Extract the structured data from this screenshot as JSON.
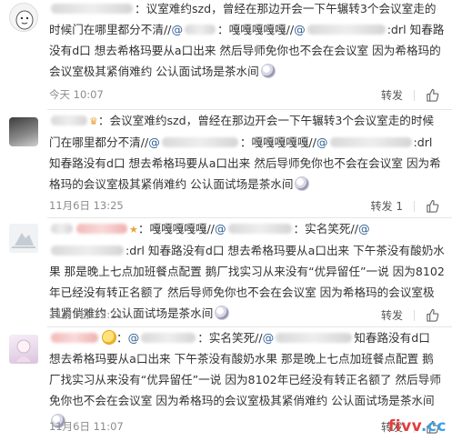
{
  "repost_label": "转发",
  "watermark": {
    "left": "fivv",
    "dot": ".",
    "right": "cc"
  },
  "posts": [
    {
      "prefix": "：",
      "text_a": "议室难约szd，曾经在那边开会一下午辗转3个会议室走的时候门在哪里都分不清//",
      "mention": "@",
      "text_b": "：嘎嘎嘎嘎嘎//",
      "text_c": ":drl 知春路没有d口 想去希格玛要从a口出来 然后导师免你也不会在会议室 因为希格玛的会议室极其紧俏难约 公认面试场是茶水间",
      "time": "今天 10:07",
      "repost": "转发",
      "repost_count": ""
    },
    {
      "prefix": "：",
      "text_a": "会议室难约szd，曾经在那边开会一下午辗转3个会议室走的时候门在哪里都分不清//",
      "mention": "@",
      "text_b": "：嘎嘎嘎嘎嘎//",
      "text_c": ":drl 知春路没有d口 想去希格玛要从a口出来 然后导师免你也不会在会议室 因为希格玛的会议室极其紧俏难约 公认面试场是茶水间",
      "time": "11月6日 13:25",
      "repost": "转发",
      "repost_count": "1"
    },
    {
      "prefix": "：嘎嘎嘎嘎嘎//",
      "mention": "@",
      "text_b": "：实名笑死//",
      "text_c": ":drl 知春路没有d口 想去希格玛要从a口出来 下午茶没有酸奶水果 那是晚上七点加班餐点配置 鹅厂找实习从来没有“优异留任”一说 因为8102年已经没有转正名额了 然后导师免你也不会在会议室 因为希格玛的会议室极其紧俏难约 公认面试场是茶水间",
      "time": "11月6日 12:21",
      "repost": "转发",
      "repost_count": ""
    },
    {
      "prefix": "：",
      "mention": "@",
      "text_b": "：实名笑死//",
      "text_c": "知春路没有d口 想去希格玛要从a口出来 下午茶没有酸奶水果 那是晚上七点加班餐点配置 鹅厂找实习从来没有“优异留任”一说 因为8102年已经没有转正名额了 然后导师免你也不会在会议室 因为希格玛的会议室极其紧俏难约 公认面试场是茶水间",
      "time": "11月6日 11:07",
      "repost": "转发",
      "repost_count": ""
    }
  ]
}
